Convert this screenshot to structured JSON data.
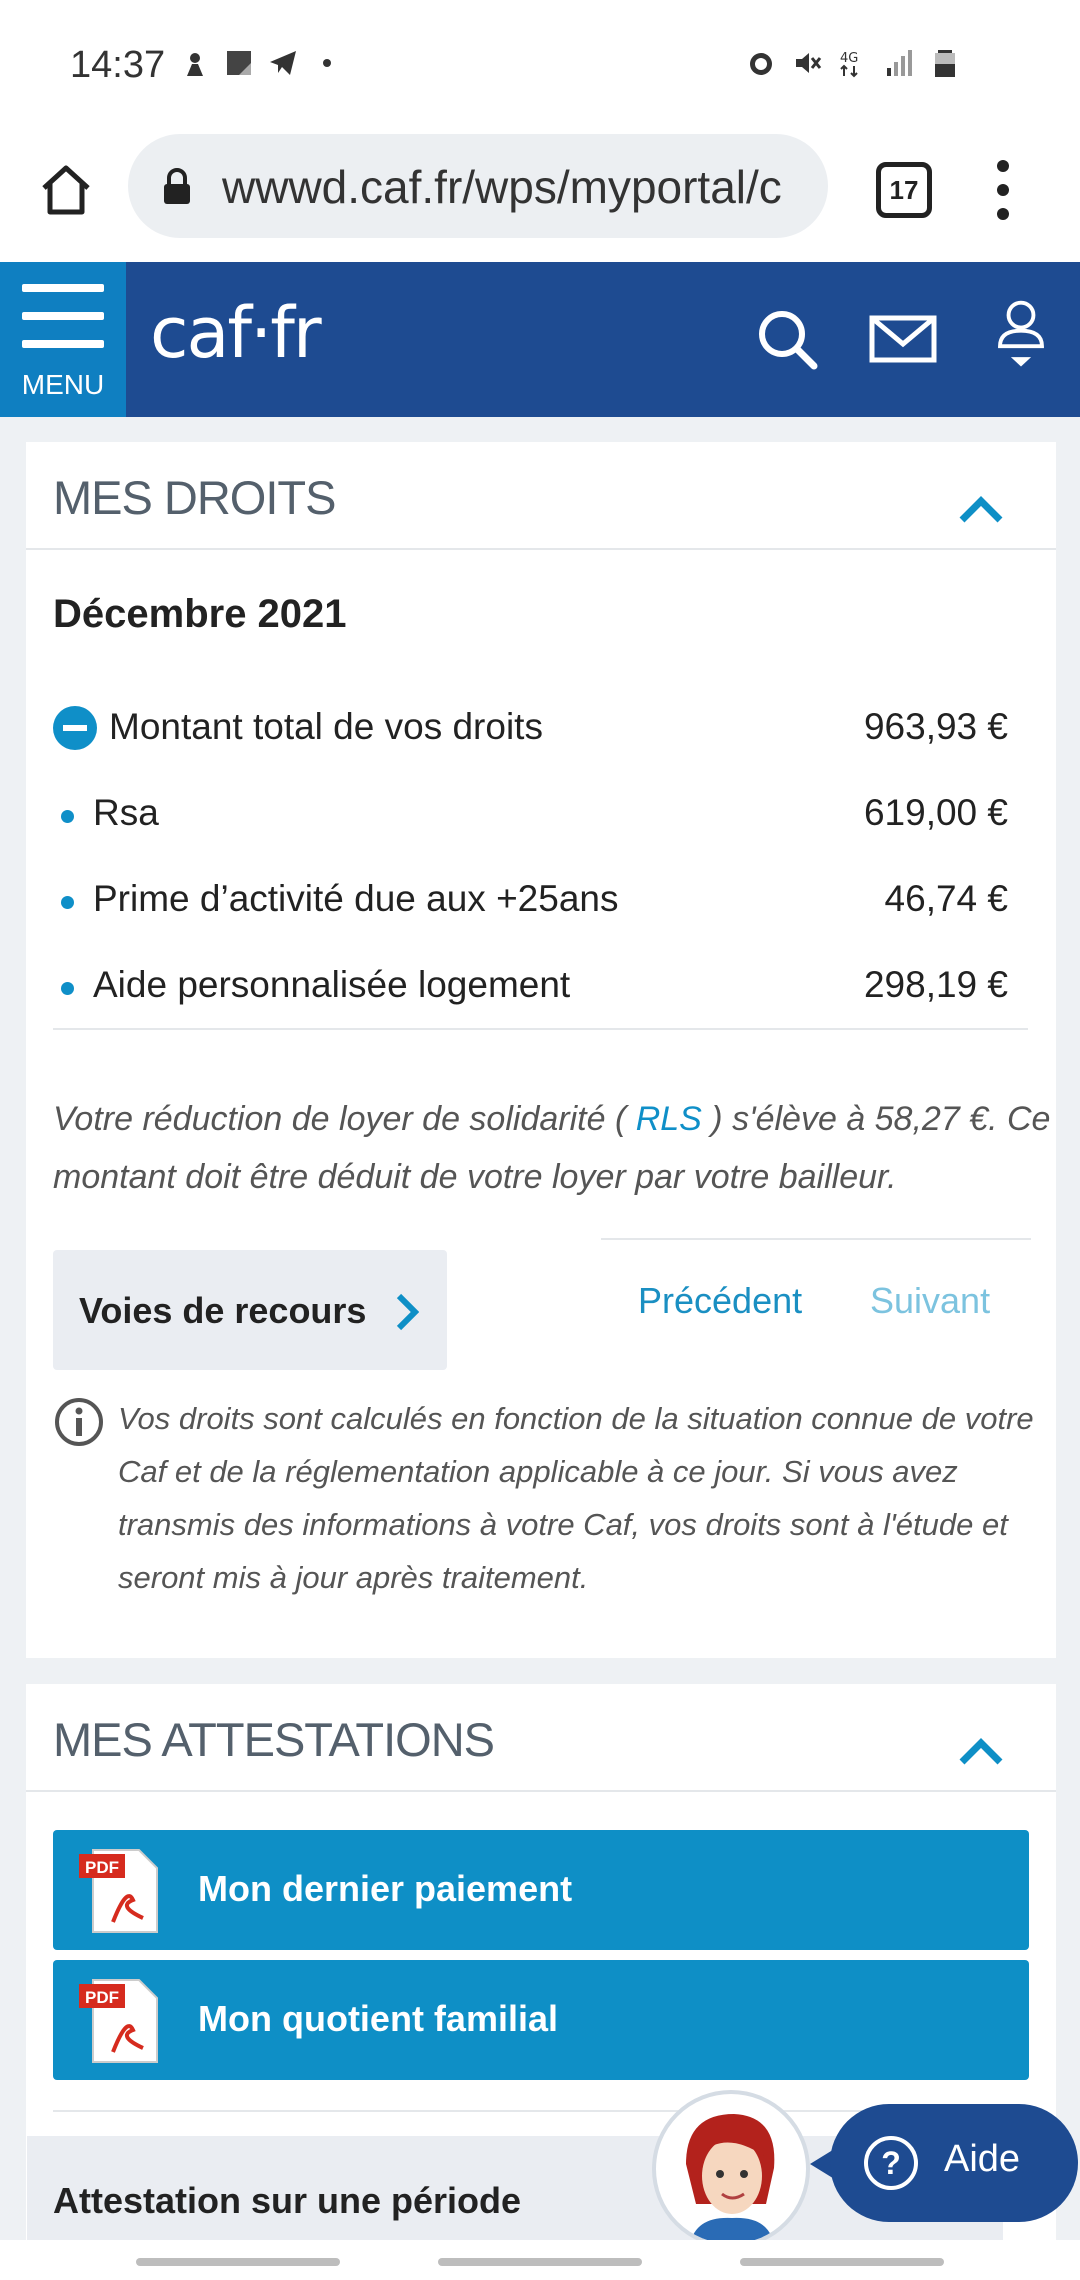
{
  "status_bar": {
    "time": "14:37",
    "left_icons": [
      "mascot-icon",
      "notes-icon",
      "telegram-icon",
      "dot-icon"
    ],
    "right_icons": [
      "alarm-icon",
      "mute-icon",
      "4g-icon",
      "signal-icon",
      "battery-icon"
    ],
    "network": "4G"
  },
  "browser": {
    "url": "wwwd.caf.fr/wps/myportal/c",
    "tab_count": "17"
  },
  "header": {
    "menu_label": "MENU",
    "logo": "caf·fr",
    "icons": [
      "search-icon",
      "mail-icon",
      "user-icon"
    ]
  },
  "droits": {
    "title": "MES DROITS",
    "month": "Décembre 2021",
    "total": {
      "label": "Montant total de vos droits",
      "value": "963,93 €"
    },
    "items": [
      {
        "label": "Rsa",
        "value": "619,00 €"
      },
      {
        "label": "Prime d’activité due aux +25ans",
        "value": "46,74 €"
      },
      {
        "label": "Aide personnalisée logement",
        "value": "298,19 €"
      }
    ],
    "rls_before": "Votre réduction de loyer de solidarité ( ",
    "rls_link": "RLS",
    "rls_after": " ) s'élève à 58,27 €. Ce montant doit être déduit de votre loyer par votre bailleur.",
    "voies": "Voies de recours",
    "prev": "Précédent",
    "next": "Suivant",
    "info": "Vos droits sont calculés en fonction de la situation connue de votre Caf et de la réglementation applicable à ce jour. Si vous avez transmis des informations à votre Caf, vos droits sont à l'étude et seront mis à jour après traitement."
  },
  "attestations": {
    "title": "MES ATTESTATIONS",
    "buttons": [
      {
        "label": "Mon dernier paiement",
        "icon": "pdf-icon",
        "icon_text": "PDF"
      },
      {
        "label": "Mon quotient familial",
        "icon": "pdf-icon",
        "icon_text": "PDF"
      }
    ],
    "periode": "Attestation sur une période"
  },
  "aide": {
    "label": "Aide"
  },
  "colors": {
    "header": "#1e4b91",
    "accent": "#0e8fc6",
    "menu": "#0f7fc1"
  }
}
